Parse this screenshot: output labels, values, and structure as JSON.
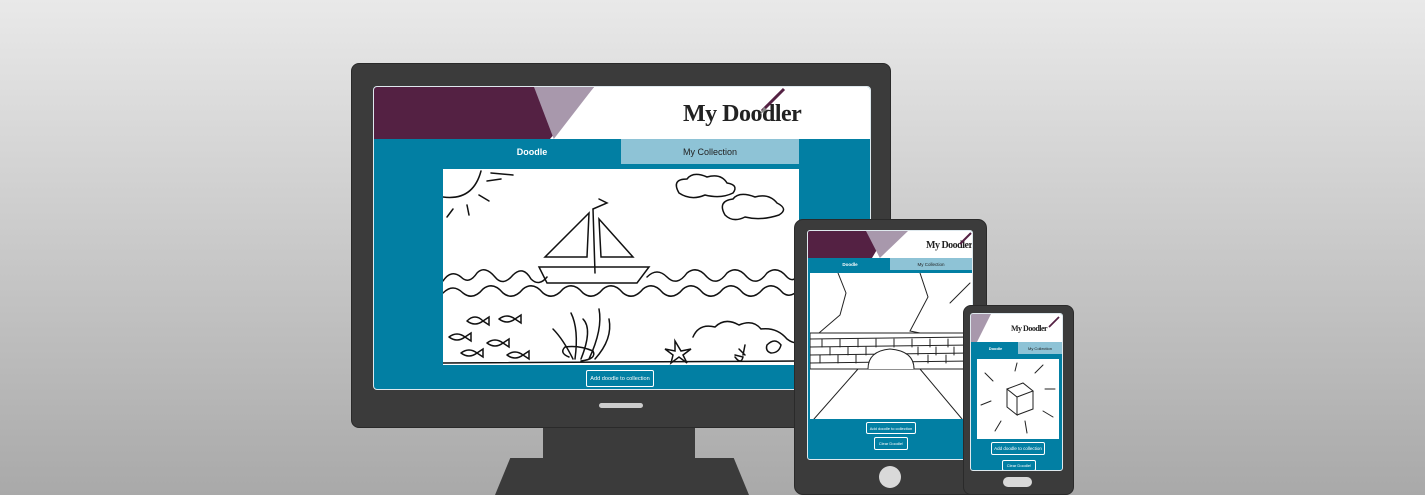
{
  "app": {
    "title": "My Doodler"
  },
  "tabs": {
    "doodle": "Doodle",
    "collection": "My Collection"
  },
  "actions": {
    "add_label": "Add doodle to collection",
    "clear_label": "Clear Doodle!"
  },
  "colors": {
    "brand_dark": "#542143",
    "brand_light": "#a898ac",
    "teal": "#027fa3",
    "tab_inactive": "#8ec3d6",
    "device": "#3b3b3b"
  },
  "icons": {
    "logo_brush": "paintbrush-icon",
    "home_button": "home-button-icon"
  }
}
